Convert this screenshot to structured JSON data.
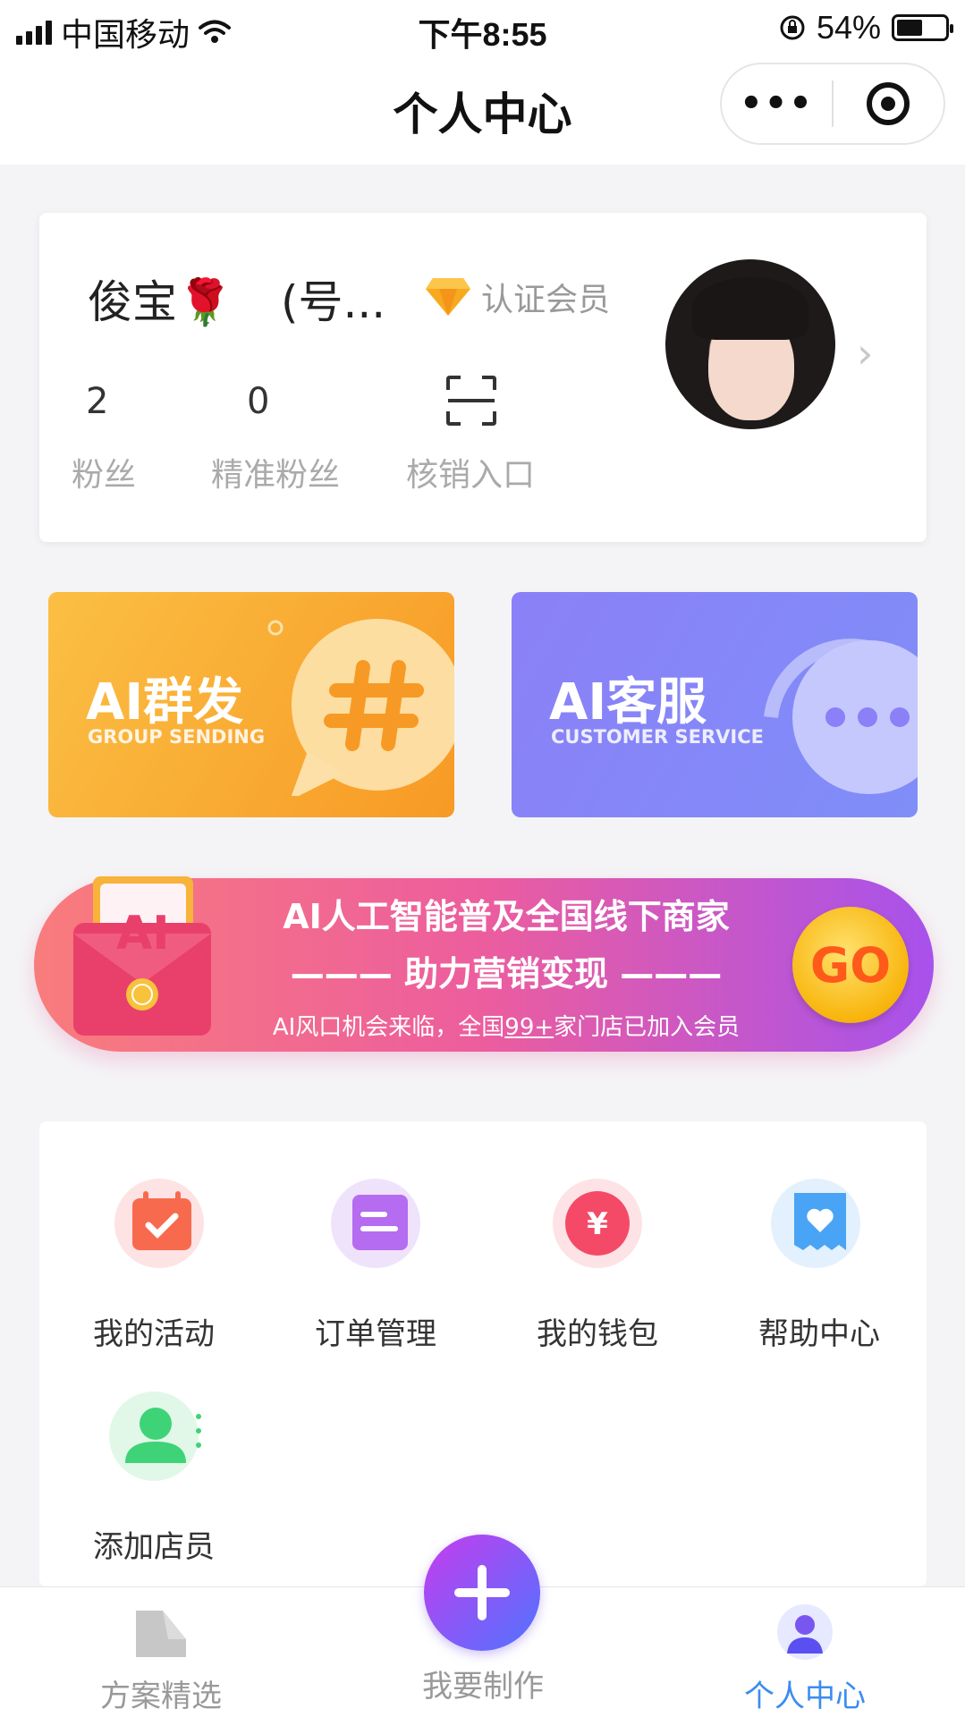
{
  "status_bar": {
    "carrier": "中国移动",
    "time": "下午8:55",
    "battery_text": "54%",
    "battery_level": 0.54
  },
  "nav": {
    "title": "个人中心"
  },
  "profile": {
    "name": "俊宝🌹",
    "account": "(号...",
    "member_label": "认证会员",
    "stats": [
      {
        "value": "2",
        "label": "粉丝"
      },
      {
        "value": "0",
        "label": "精准粉丝"
      }
    ],
    "scan_label": "核销入口"
  },
  "ai_cards": [
    {
      "title": "AI群发",
      "subtitle": "GROUP SENDING"
    },
    {
      "title": "AI客服",
      "subtitle": "CUSTOMER SERVICE"
    }
  ],
  "banner": {
    "line1": "AI人工智能普及全国线下商家",
    "line2": "——— 助力营销变现 ———",
    "line3_pre": "AI风口机会来临，全国",
    "line3_count": "99+",
    "line3_post": "家门店已加入会员",
    "go_label": "GO",
    "badge_text": "AI"
  },
  "menu": [
    {
      "label": "我的活动",
      "icon": "calendar-check-icon"
    },
    {
      "label": "订单管理",
      "icon": "document-icon"
    },
    {
      "label": "我的钱包",
      "icon": "yen-coin-icon"
    },
    {
      "label": "帮助中心",
      "icon": "heart-ticket-icon"
    },
    {
      "label": "添加店员",
      "icon": "add-user-icon"
    }
  ],
  "tabs": [
    {
      "label": "方案精选",
      "icon": "folder-icon"
    },
    {
      "label": "我要制作",
      "icon": "plus-icon"
    },
    {
      "label": "个人中心",
      "icon": "person-icon",
      "active": true
    }
  ],
  "colors": {
    "accent_blue": "#3b8cf0",
    "orange": "#f79a25",
    "purple": "#8b80f7"
  }
}
